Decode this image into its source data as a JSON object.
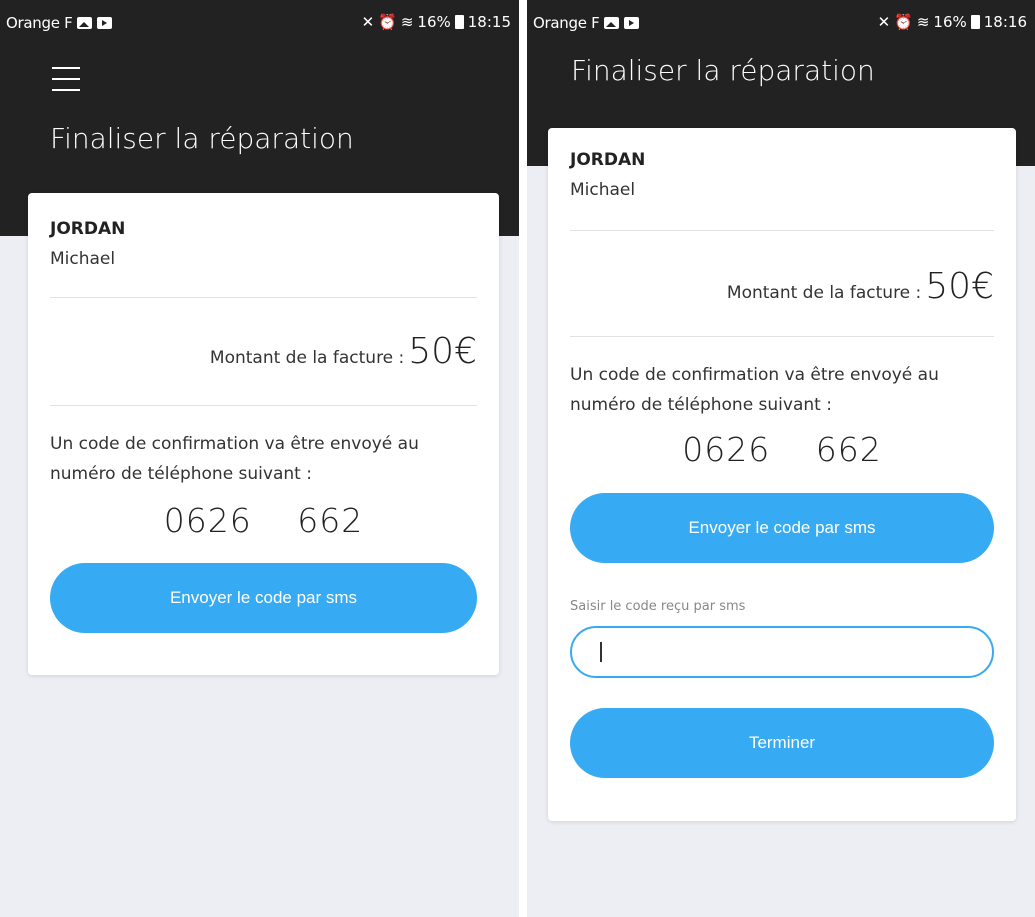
{
  "screens": [
    {
      "status": {
        "carrier": "Orange F",
        "battery": "16%",
        "time": "18:15"
      },
      "title": "Finaliser la réparation",
      "customer": {
        "last_name": "JORDAN",
        "first_name": "Michael"
      },
      "invoice": {
        "label": "Montant de la facture :",
        "amount": "50€"
      },
      "confirmation_text": "Un code de confirmation va être envoyé au numéro de téléphone suivant :",
      "phone_number": "0626      662",
      "send_button": "Envoyer le code par sms"
    },
    {
      "status": {
        "carrier": "Orange F",
        "battery": "16%",
        "time": "18:16"
      },
      "title": "Finaliser la réparation",
      "customer": {
        "last_name": "JORDAN",
        "first_name": "Michael"
      },
      "invoice": {
        "label": "Montant de la facture :",
        "amount": "50€"
      },
      "confirmation_text": "Un code de confirmation va être envoyé au numéro de téléphone suivant :",
      "phone_number": "0626      662",
      "send_button": "Envoyer le code par sms",
      "code_field": {
        "label": "Saisir le code reçu par sms",
        "value": ""
      },
      "finish_button": "Terminer"
    }
  ],
  "colors": {
    "header": "#222222",
    "accent": "#36aaf2",
    "background": "#eceef3"
  }
}
